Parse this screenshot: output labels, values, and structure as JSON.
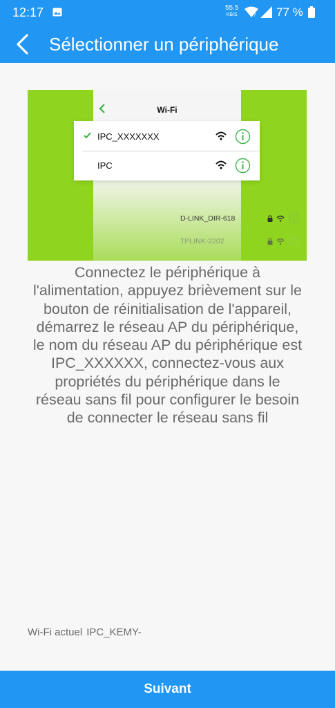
{
  "status_bar": {
    "time": "12:17",
    "net_speed": "55.5",
    "net_speed_unit": "KB/S",
    "battery": "77 %"
  },
  "header": {
    "title": "Sélectionner un périphérique",
    "back_icon": "chevron-left-icon"
  },
  "illustration": {
    "screen_title": "Wi-Fi",
    "networks": [
      {
        "name": "IPC_XXXXXXX",
        "checked": true
      },
      {
        "name": "IPC",
        "checked": false
      }
    ],
    "other_networks": [
      {
        "name": "D-LINK_DIR-618"
      },
      {
        "name": "TPLINK-2202"
      }
    ]
  },
  "instructions": "Connectez le périphérique à l'alimentation, appuyez brièvement sur le bouton de réinitialisation de l'appareil, démarrez le réseau AP du périphérique, le nom du réseau AP du périphérique est IPC_XXXXXX, connectez-vous aux propriétés du périphérique dans le réseau sans fil pour configurer le besoin de connecter le réseau sans fil",
  "current_wifi": {
    "label": "Wi-Fi actuel",
    "value": "IPC_KEMY-"
  },
  "footer": {
    "next_label": "Suivant"
  },
  "colors": {
    "primary": "#2196f3",
    "illustration_green": "#8fd41f",
    "check_green": "#3cb44a"
  }
}
